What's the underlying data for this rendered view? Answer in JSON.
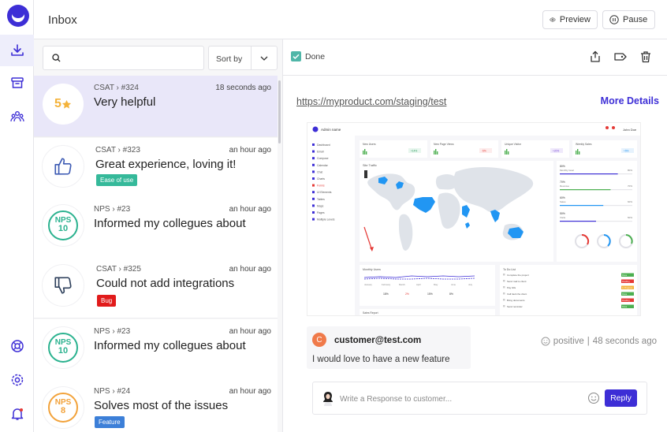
{
  "header": {
    "title": "Inbox",
    "preview_label": "Preview",
    "pause_label": "Pause"
  },
  "rail": {
    "icons": [
      "logo",
      "download-icon",
      "archive-icon",
      "people-icon",
      "lifebuoy-icon",
      "settings-icon",
      "bell-icon"
    ]
  },
  "list": {
    "search_placeholder": "",
    "search_value": "",
    "sort_label": "Sort by",
    "items": [
      {
        "meta": "CSAT › #324",
        "time": "18 seconds ago",
        "title": "Very helpful",
        "badge_text": "5",
        "tag": ""
      },
      {
        "meta": "CSAT › #323",
        "time": "an hour ago",
        "title": "Great experience, loving it!",
        "tag": "Ease of use"
      },
      {
        "meta": "NPS › #23",
        "time": "an hour ago",
        "title": "Informed my collegues about",
        "nps_label": "NPS",
        "nps_value": "10",
        "tag": ""
      },
      {
        "meta": "CSAT › #325",
        "time": "an hour ago",
        "title": "Could not add integrations",
        "tag": "Bug"
      },
      {
        "meta": "NPS › #23",
        "time": "an hour ago",
        "title": "Informed my collegues about",
        "nps_label": "NPS",
        "nps_value": "10",
        "tag": ""
      },
      {
        "meta": "NPS › #24",
        "time": "an hour ago",
        "title": "Solves most of the issues",
        "nps_label": "NPS",
        "nps_value": "8",
        "tag": "Feature"
      }
    ]
  },
  "detail": {
    "done_label": "Done",
    "url": "https://myproduct.com/staging/test",
    "more_details": "More Details",
    "comment": {
      "avatar_letter": "C",
      "email": "customer@test.com",
      "text": "I would love to have a new feature",
      "sentiment": "positive",
      "separator": "|",
      "time": "48 seconds ago"
    },
    "reply": {
      "placeholder": "Write a Response to customer...",
      "button": "Reply"
    }
  },
  "screenshot": {
    "app_name": "Admin name",
    "user": "John Doe",
    "nav": [
      "Dashboard",
      "Email",
      "Compose",
      "Calendar",
      "Chat",
      "Charts",
      "Forms",
      "UI Elements",
      "Tables",
      "Maps",
      "Pages",
      "Multiple Levels"
    ],
    "stats": [
      "New Users",
      "New Page Views",
      "Unique Visitor",
      "Weekly Sales"
    ],
    "stat_deltas": [
      "+14%",
      "-5%",
      "+20%",
      "+5%"
    ],
    "map_title": "Site Traffic",
    "goals": [
      "Monthly Goal",
      "Revenue",
      "Sales",
      "Visits"
    ],
    "goal_pcts": [
      "80%",
      "70%",
      "60%",
      "50%"
    ],
    "chart_title": "Monthly Users",
    "months": [
      "January",
      "February",
      "March",
      "April",
      "May",
      "June",
      "July"
    ],
    "chart_footer": [
      "18%",
      "2%",
      "15%",
      "8%"
    ],
    "todo_title": "To Do List",
    "todos": [
      "Complete the project",
      "Send mail to client",
      "Pay bills",
      "Call back the client",
      "Bring documents",
      "Send reminder"
    ],
    "todo_status": [
      "Done",
      "Pending",
      "In Progress",
      "Done",
      "Pending",
      "Done"
    ],
    "sales_report": "Sales Report"
  },
  "colors": {
    "accent": "#3d2ed6",
    "selected_bg": "#e9e7f9",
    "nps_green": "#2bb28f",
    "nps_orange": "#f2a23a",
    "star": "#f4b33b",
    "tag_ease": "#35b99a",
    "tag_bug": "#e11b1b",
    "tag_feature": "#3c7fd8",
    "done": "#4fb6a8"
  }
}
